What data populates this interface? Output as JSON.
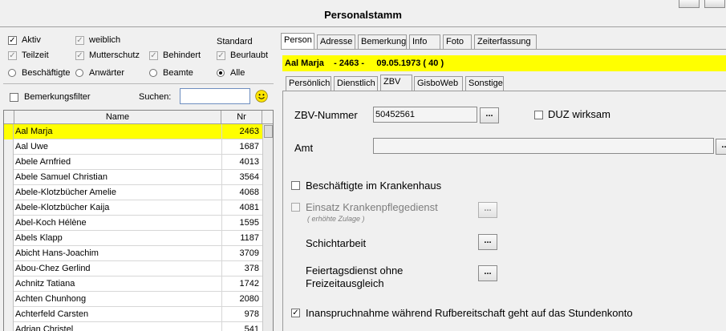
{
  "window": {
    "title": "Personalstamm"
  },
  "filters": {
    "row1": [
      {
        "label": "Aktiv",
        "checked": true,
        "disabled": false
      },
      {
        "label": "weiblich",
        "checked": true,
        "disabled": true
      },
      {
        "label": "Standard",
        "checked": null,
        "disabled": false
      }
    ],
    "row2": [
      {
        "label": "Teilzeit",
        "checked": true,
        "disabled": true
      },
      {
        "label": "Mutterschutz",
        "checked": true,
        "disabled": true
      },
      {
        "label": "Behindert",
        "checked": true,
        "disabled": true
      },
      {
        "label": "Beurlaubt",
        "checked": true,
        "disabled": true
      }
    ],
    "radios": [
      {
        "label": "Beschäftigte",
        "selected": false
      },
      {
        "label": "Anwärter",
        "selected": false
      },
      {
        "label": "Beamte",
        "selected": false
      },
      {
        "label": "Alle",
        "selected": true
      }
    ],
    "remark_filter": {
      "label": "Bemerkungsfilter",
      "checked": false
    },
    "search": {
      "label": "Suchen:",
      "value": ""
    },
    "smiley": "smiley-icon"
  },
  "list": {
    "headers": {
      "name": "Name",
      "nr": "Nr"
    },
    "rows": [
      {
        "name": "Aal Marja",
        "nr": "2463",
        "selected": true
      },
      {
        "name": "Aal Uwe",
        "nr": "1687"
      },
      {
        "name": "Abele Arnfried",
        "nr": "4013"
      },
      {
        "name": "Abele Samuel Christian",
        "nr": "3564"
      },
      {
        "name": "Abele-Klotzbücher Amelie",
        "nr": "4068"
      },
      {
        "name": "Abele-Klotzbücher Kaija",
        "nr": "4081"
      },
      {
        "name": "Abel-Koch Hélène",
        "nr": "1595"
      },
      {
        "name": "Abels Klapp",
        "nr": "1187"
      },
      {
        "name": "Abicht Hans-Joachim",
        "nr": "3709"
      },
      {
        "name": "Abou-Chez Gerlind",
        "nr": "378"
      },
      {
        "name": "Achnitz Tatiana",
        "nr": "1742"
      },
      {
        "name": "Achten Chunhong",
        "nr": "2080"
      },
      {
        "name": "Achterfeld Carsten",
        "nr": "978"
      },
      {
        "name": "Adrian Christel",
        "nr": "541"
      }
    ]
  },
  "tabs": [
    "Person",
    "Adresse",
    "Bemerkung",
    "Info",
    "Foto",
    "Zeiterfassung"
  ],
  "active_tab": "Person",
  "selected_person": "Aal Marja    - 2463 -     09.05.1973 ( 40 )",
  "subtabs": [
    "Persönlich",
    "Dienstlich",
    "ZBV",
    "GisboWeb",
    "Sonstige"
  ],
  "active_subtab": "ZBV",
  "zbv": {
    "nummer_label": "ZBV-Nummer",
    "nummer_value": "50452561",
    "button_label": "...",
    "duz_label": "DUZ wirksam",
    "amt_label": "Amt",
    "amt_value": "",
    "krankenhaus_label": "Beschäftigte im Krankenhaus",
    "einsatz_label": "Einsatz Krankenpflegedienst",
    "einsatz_sub": "( erhöhte Zulage )",
    "schicht_label": "Schichtarbeit",
    "feiertag_line1": "Feiertagsdienst ohne",
    "feiertag_line2": "Freizeitausgleich",
    "rufbereitschaft_label": "Inanspruchnahme während Rufbereitschaft geht auf das Stundenkonto"
  },
  "colors": {
    "selection": "#ffff00",
    "background": "#f0f0f0"
  }
}
